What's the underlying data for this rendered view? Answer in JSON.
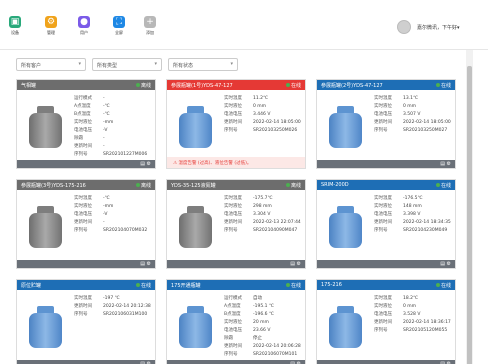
{
  "nav": [
    {
      "label": "设备",
      "icon": "device-icon",
      "color": "#29a97b"
    },
    {
      "label": "管理",
      "icon": "manage-icon",
      "color": "#f0a31b"
    },
    {
      "label": "用户",
      "icon": "user-icon",
      "color": "#7b5be8"
    },
    {
      "label": "全屏",
      "icon": "fullscreen-icon",
      "color": "#1e88e5"
    },
    {
      "label": "添加",
      "icon": "add-icon",
      "color": "#b8b8b8"
    }
  ],
  "user": {
    "greeting": "嘉尔微讯，下午好▾"
  },
  "filters": [
    {
      "value": "所有客户"
    },
    {
      "value": "所有类型"
    },
    {
      "value": "所有状态"
    }
  ],
  "cards": [
    {
      "title": "气相罐",
      "status": "离线",
      "head_color": "#6d6d6d",
      "tank": "gray",
      "footer": "normal",
      "rows": [
        [
          "运行模式",
          "-"
        ],
        [
          "A点温度",
          "-℃"
        ],
        [
          "B点温度",
          "-℃"
        ],
        [
          "实时液位",
          "-mm"
        ],
        [
          "电池电压",
          "-V"
        ],
        [
          "除霜",
          "-"
        ],
        [
          "更新时间",
          "-"
        ],
        [
          "序列号",
          "SR202101227M006"
        ]
      ]
    },
    {
      "title": "参展瓶罐(1号)YDS-47-127",
      "status": "在线",
      "head_color": "#e53935",
      "tank": "blue",
      "footer": "alarm",
      "alarm": "⚠ 温度告警 (过高)、液位告警 (过低)。",
      "rows": [
        [
          "实时温度",
          "11.2℃"
        ],
        [
          "实时液位",
          "0 mm"
        ],
        [
          "电池电压",
          "3.446 V"
        ],
        [
          "更新时间",
          "2022-02-14 18:05:00"
        ],
        [
          "序列号",
          "SR202103250M026"
        ]
      ]
    },
    {
      "title": "参展瓶罐(2号)YDS-47-127",
      "status": "在线",
      "head_color": "#1e6eb5",
      "tank": "blue",
      "footer": "normal",
      "rows": [
        [
          "实时温度",
          "13.1℃"
        ],
        [
          "实时液位",
          "0 mm"
        ],
        [
          "电池电压",
          "3.507 V"
        ],
        [
          "更新时间",
          "2022-02-14 18:05:00"
        ],
        [
          "序列号",
          "SR202103250M027"
        ]
      ]
    },
    {
      "title": "参展瓶罐(3号)YDS-175-216",
      "status": "离线",
      "head_color": "#6d6d6d",
      "tank": "gray",
      "footer": "normal",
      "rows": [
        [
          "实时温度",
          "-℃"
        ],
        [
          "实时液位",
          "-mm"
        ],
        [
          "电池电压",
          "-V"
        ],
        [
          "更新时间",
          "-"
        ],
        [
          "序列号",
          "SR202104070M032"
        ]
      ]
    },
    {
      "title": "YDS-35-125液氮罐",
      "status": "离线",
      "head_color": "#6d6d6d",
      "tank": "gray",
      "footer": "normal",
      "rows": [
        [
          "实时温度",
          "-175.7℃"
        ],
        [
          "实时液位",
          "298 mm"
        ],
        [
          "电池电压",
          "3.304 V"
        ],
        [
          "更新时间",
          "2022-02-13 22:07:44"
        ],
        [
          "序列号",
          "SR202104090M047"
        ]
      ]
    },
    {
      "title": "SRIM-200D",
      "status": "在线",
      "head_color": "#1e6eb5",
      "tank": "blue",
      "footer": "normal",
      "rows": [
        [
          "实时温度",
          "-176.5℃"
        ],
        [
          "实时液位",
          "148 mm"
        ],
        [
          "电池电压",
          "3.398 V"
        ],
        [
          "更新时间",
          "2022-02-14 18:34:35"
        ],
        [
          "序列号",
          "SR202104230M049"
        ]
      ]
    },
    {
      "title": "原位贮罐",
      "status": "在线",
      "head_color": "#1e6eb5",
      "tank": "blue",
      "footer": "normal",
      "rows": [
        [
          "实时温度",
          "-197 ℃"
        ],
        [
          "更新时间",
          "2022-02-14 20:12:38"
        ],
        [
          "序列号",
          "SR202106031M100"
        ]
      ]
    },
    {
      "title": "175开通瓶罐",
      "status": "在线",
      "head_color": "#1e6eb5",
      "tank": "blue",
      "footer": "normal",
      "rows": [
        [
          "运行模式",
          "自动"
        ],
        [
          "A点温度",
          "-195.1 ℃"
        ],
        [
          "B点温度",
          "-196.6 ℃"
        ],
        [
          "实时液位",
          "20 mm"
        ],
        [
          "电池电压",
          "23.66 V"
        ],
        [
          "除霜",
          "停止"
        ],
        [
          "更新时间",
          "2022-02-14 20:06:28"
        ],
        [
          "序列号",
          "SR202106070M101"
        ]
      ]
    },
    {
      "title": "175-216",
      "status": "在线",
      "head_color": "#1e6eb5",
      "tank": "blue",
      "footer": "normal",
      "rows": [
        [
          "实时温度",
          "18.2℃"
        ],
        [
          "实时液位",
          "0 mm"
        ],
        [
          "电池电压",
          "3.528 V"
        ],
        [
          "更新时间",
          "2022-02-14 18:36:17"
        ],
        [
          "序列号",
          "SR202105120M055"
        ]
      ]
    }
  ]
}
